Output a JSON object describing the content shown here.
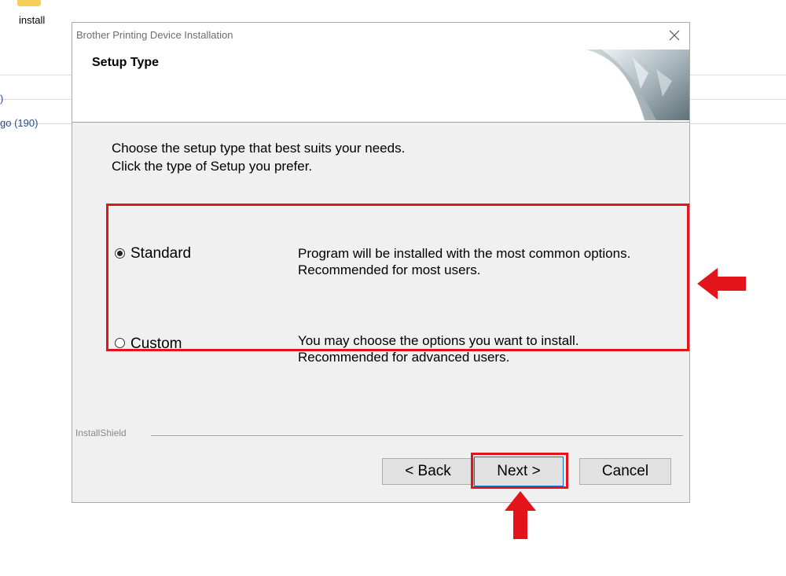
{
  "background": {
    "folder_label": "install",
    "link_1": ")",
    "link_2": "go (190)"
  },
  "dialog": {
    "title": "Brother Printing Device Installation",
    "header_title": "Setup Type",
    "instructions": [
      "Choose the setup type that best suits your needs.",
      "Click the type of Setup you prefer."
    ],
    "options": [
      {
        "label": "Standard",
        "selected": true,
        "description": [
          "Program will be installed with the most common options.",
          "Recommended for most users."
        ]
      },
      {
        "label": "Custom",
        "selected": false,
        "description": [
          "You may choose the options you want to install.",
          "Recommended for advanced users."
        ]
      }
    ],
    "installshield_label": "InstallShield",
    "buttons": {
      "back": "< Back",
      "next": "Next >",
      "cancel": "Cancel"
    }
  },
  "annotations": {
    "highlight_color": "#e3141c"
  }
}
